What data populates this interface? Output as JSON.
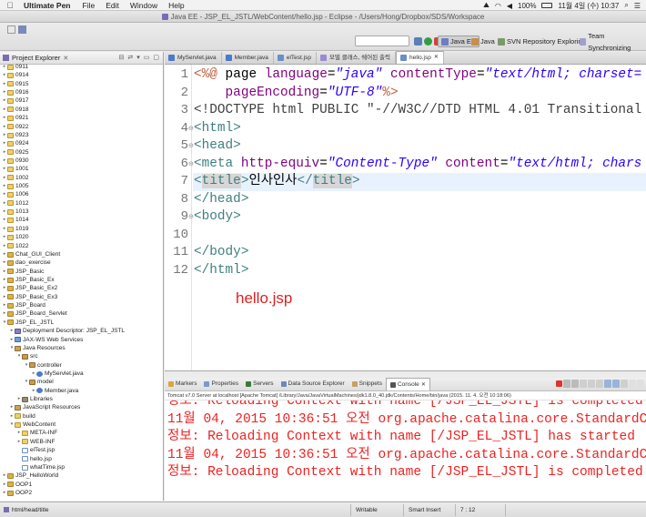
{
  "menubar": {
    "app": "Ultimate Pen",
    "items": [
      "File",
      "Edit",
      "Window",
      "Help"
    ],
    "battery": "100%",
    "datetime": "11월 4일 (수)  10:37"
  },
  "window": {
    "title": "Java EE - JSP_EL_JSTL/WebContent/hello.jsp - Eclipse - /Users/Hong/Dropbox/SDS/Workspace"
  },
  "toolbar": {
    "perspectives": [
      "Java EE",
      "Java",
      "SVN Repository Exploring",
      "Team Synchronizing"
    ]
  },
  "explorer": {
    "title": "Project Explorer",
    "rows": [
      {
        "indent": 0,
        "twisty": "▸",
        "icon": "folder",
        "label": "0911"
      },
      {
        "indent": 0,
        "twisty": "▸",
        "icon": "folder",
        "label": "0914"
      },
      {
        "indent": 0,
        "twisty": "▸",
        "icon": "folder",
        "label": "0915"
      },
      {
        "indent": 0,
        "twisty": "▸",
        "icon": "folder",
        "label": "0916"
      },
      {
        "indent": 0,
        "twisty": "▸",
        "icon": "folder",
        "label": "0917"
      },
      {
        "indent": 0,
        "twisty": "▸",
        "icon": "folder",
        "label": "0918"
      },
      {
        "indent": 0,
        "twisty": "▸",
        "icon": "folder",
        "label": "0921"
      },
      {
        "indent": 0,
        "twisty": "▸",
        "icon": "folder",
        "label": "0922"
      },
      {
        "indent": 0,
        "twisty": "▸",
        "icon": "folder",
        "label": "0923"
      },
      {
        "indent": 0,
        "twisty": "▸",
        "icon": "folder",
        "label": "0924"
      },
      {
        "indent": 0,
        "twisty": "▸",
        "icon": "folder",
        "label": "0925"
      },
      {
        "indent": 0,
        "twisty": "▸",
        "icon": "folder",
        "label": "0930"
      },
      {
        "indent": 0,
        "twisty": "▸",
        "icon": "folder",
        "label": "1001"
      },
      {
        "indent": 0,
        "twisty": "▸",
        "icon": "folder",
        "label": "1002"
      },
      {
        "indent": 0,
        "twisty": "▸",
        "icon": "folder",
        "label": "1005"
      },
      {
        "indent": 0,
        "twisty": "▸",
        "icon": "folder",
        "label": "1006"
      },
      {
        "indent": 0,
        "twisty": "▸",
        "icon": "folder",
        "label": "1012"
      },
      {
        "indent": 0,
        "twisty": "▸",
        "icon": "folder",
        "label": "1013"
      },
      {
        "indent": 0,
        "twisty": "▸",
        "icon": "folder",
        "label": "1014"
      },
      {
        "indent": 0,
        "twisty": "▸",
        "icon": "folder",
        "label": "1019"
      },
      {
        "indent": 0,
        "twisty": "▸",
        "icon": "folder",
        "label": "1020"
      },
      {
        "indent": 0,
        "twisty": "▸",
        "icon": "folder",
        "label": "1022"
      },
      {
        "indent": 0,
        "twisty": "▸",
        "icon": "proj",
        "label": "Chat_GUI_Client"
      },
      {
        "indent": 0,
        "twisty": "▸",
        "icon": "proj",
        "label": "dao_exercise"
      },
      {
        "indent": 0,
        "twisty": "▸",
        "icon": "proj",
        "label": "JSP_Basic"
      },
      {
        "indent": 0,
        "twisty": "▸",
        "icon": "proj",
        "label": "JSP_Basic_Ex"
      },
      {
        "indent": 0,
        "twisty": "▸",
        "icon": "proj",
        "label": "JSP_Basic_Ex2"
      },
      {
        "indent": 0,
        "twisty": "▸",
        "icon": "proj",
        "label": "JSP_Basic_Ex3"
      },
      {
        "indent": 0,
        "twisty": "▸",
        "icon": "proj",
        "label": "JSP_Board"
      },
      {
        "indent": 0,
        "twisty": "▸",
        "icon": "proj",
        "label": "JSP_Board_Servlet"
      },
      {
        "indent": 0,
        "twisty": "▾",
        "icon": "proj",
        "label": "JSP_EL_JSTL"
      },
      {
        "indent": 1,
        "twisty": "▸",
        "icon": "desc",
        "label": "Deployment Descriptor: JSP_EL_JSTL"
      },
      {
        "indent": 1,
        "twisty": "▸",
        "icon": "ws",
        "label": "JAX-WS Web Services"
      },
      {
        "indent": 1,
        "twisty": "▾",
        "icon": "jar",
        "label": "Java Resources"
      },
      {
        "indent": 2,
        "twisty": "▾",
        "icon": "pkg",
        "label": "src"
      },
      {
        "indent": 3,
        "twisty": "▾",
        "icon": "pkg",
        "label": "controller"
      },
      {
        "indent": 4,
        "twisty": "▸",
        "icon": "java",
        "label": "MyServlet.java"
      },
      {
        "indent": 3,
        "twisty": "▾",
        "icon": "pkg",
        "label": "model"
      },
      {
        "indent": 4,
        "twisty": "▸",
        "icon": "java",
        "label": "Member.java"
      },
      {
        "indent": 2,
        "twisty": "▸",
        "icon": "lib",
        "label": "Libraries"
      },
      {
        "indent": 1,
        "twisty": "▸",
        "icon": "jar",
        "label": "JavaScript Resources"
      },
      {
        "indent": 1,
        "twisty": "▸",
        "icon": "folder",
        "label": "build"
      },
      {
        "indent": 1,
        "twisty": "▾",
        "icon": "folder",
        "label": "WebContent"
      },
      {
        "indent": 2,
        "twisty": "▸",
        "icon": "folder",
        "label": "META-INF"
      },
      {
        "indent": 2,
        "twisty": "▸",
        "icon": "folder",
        "label": "WEB-INF"
      },
      {
        "indent": 2,
        "twisty": "",
        "icon": "jsp",
        "label": "elTest.jsp"
      },
      {
        "indent": 2,
        "twisty": "",
        "icon": "jsp",
        "label": "hello.jsp"
      },
      {
        "indent": 2,
        "twisty": "",
        "icon": "jsp",
        "label": "whatTime.jsp"
      },
      {
        "indent": 0,
        "twisty": "▸",
        "icon": "proj",
        "label": "JSP_HelloWorld"
      },
      {
        "indent": 0,
        "twisty": "▸",
        "icon": "proj",
        "label": "OOP1"
      },
      {
        "indent": 0,
        "twisty": "▸",
        "icon": "proj",
        "label": "OOP2"
      }
    ]
  },
  "editor": {
    "tabs": [
      {
        "label": "MyServlet.java",
        "active": false
      },
      {
        "label": "Member.java",
        "active": false
      },
      {
        "label": "elTest.jsp",
        "active": false
      },
      {
        "label": "모델 클래스, 쉐어된 출력",
        "active": false
      },
      {
        "label": "hello.jsp",
        "active": true
      }
    ],
    "line_numbers": [
      "1",
      "2",
      "3",
      "4",
      "5",
      "6",
      "7",
      "8",
      "9",
      "10",
      "11",
      "12"
    ],
    "lines": [
      [
        "<%@",
        " page ",
        "language",
        "=",
        "\"java\"",
        " ",
        "contentType",
        "=",
        "\"text/html; charset="
      ],
      [
        "    ",
        "pageEncoding",
        "=",
        "\"UTF-8\"",
        "%>"
      ],
      [
        "<!DOCTYPE html PUBLIC \"-//W3C//DTD HTML 4.01 Transitional"
      ],
      [
        "<html>"
      ],
      [
        "<head>"
      ],
      [
        "<meta",
        " ",
        "http-equiv",
        "=",
        "\"Content-Type\"",
        " ",
        "content",
        "=",
        "\"text/html; chars"
      ],
      [
        "<",
        "title",
        ">",
        "인사인사",
        "</",
        "title",
        ">"
      ],
      [
        "</head>"
      ],
      [
        "<body>"
      ],
      [
        ""
      ],
      [
        "</body>"
      ],
      [
        "</html>"
      ]
    ],
    "annotation": "hello.jsp"
  },
  "console": {
    "tabs": [
      "Markers",
      "Properties",
      "Servers",
      "Data Source Explorer",
      "Snippets",
      "Console"
    ],
    "header": "Tomcat v7.0 Server at localhost [Apache Tomcat] /Library/Java/JavaVirtualMachines/jdk1.8.0_40.jdk/Contents/Home/bin/java (2015. 11. 4. 오전 10:18:06)",
    "lines": [
      "정보: Reloading Context with name [/JSP_EL_JSTL] is completed",
      "11월 04, 2015 10:36:51 오전 org.apache.catalina.core.StandardCo",
      "정보: Reloading Context with name [/JSP_EL_JSTL] has started",
      "11월 04, 2015 10:36:51 오전 org.apache.catalina.core.StandardCo",
      "정보: Reloading Context with name [/JSP_EL_JSTL] is completed"
    ]
  },
  "status": {
    "path": "html/head/title",
    "mode": "Writable",
    "insert": "Smart Insert",
    "position": "7 : 12"
  }
}
